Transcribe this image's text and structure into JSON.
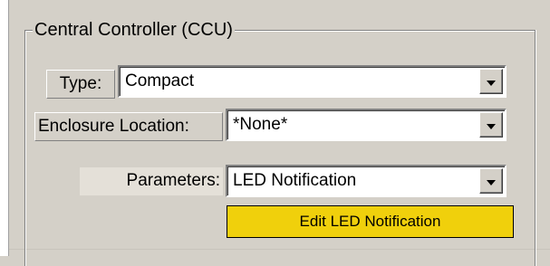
{
  "group": {
    "title": "Central Controller (CCU)"
  },
  "fields": {
    "type": {
      "label": "Type:",
      "value": "Compact"
    },
    "enclosure_location": {
      "label": "Enclosure Location:",
      "value": "*None*"
    },
    "parameters": {
      "label": "Parameters:",
      "value": "LED Notification"
    }
  },
  "buttons": {
    "edit_label": "Edit LED Notification",
    "edit_color": "#f0d00c"
  },
  "icons": {
    "dropdown": "chevron-down-icon"
  }
}
